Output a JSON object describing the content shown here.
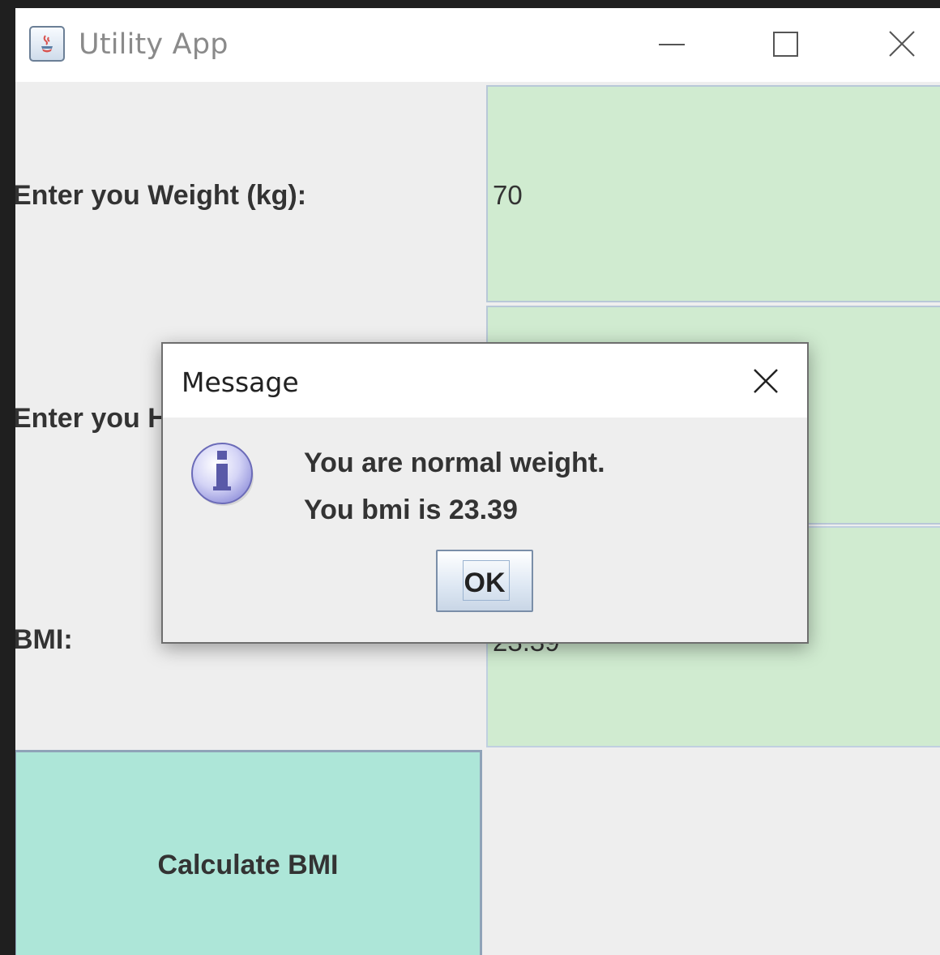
{
  "window": {
    "title": "Utility App",
    "controls": [
      "minimize-icon",
      "maximize-icon",
      "close-icon"
    ]
  },
  "form": {
    "weight_label": "Enter you Weight (kg):",
    "weight_value": "70",
    "height_label": "Enter you H",
    "bmi_label": "BMI:",
    "bmi_value": "23.39",
    "calculate_button": "Calculate BMI"
  },
  "dialog": {
    "title": "Message",
    "icon": "info-icon",
    "message_line1": "You are normal weight.",
    "message_line2": "You bmi is 23.39",
    "ok_label": "OK"
  },
  "colors": {
    "field_bg": "#d0ebd0",
    "button_bg": "#ade6d8",
    "window_bg": "#eeeeee"
  }
}
